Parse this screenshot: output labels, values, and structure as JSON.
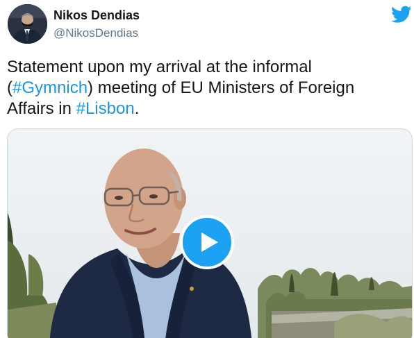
{
  "author": {
    "name": "Nikos Dendias",
    "handle": "@NikosDendias"
  },
  "tweet": {
    "line1": "Statement upon my arrival at the informal",
    "line2_prefix": "(",
    "hashtag1": "#Gymnich",
    "line2_suffix": ") meeting of EU Ministers of Foreign",
    "line3_prefix": "Affairs in ",
    "hashtag2": "#Lisbon",
    "line3_suffix": "."
  },
  "icons": {
    "brand": "twitter-bird-icon",
    "media": "play-icon"
  },
  "colors": {
    "accent": "#1da1f2",
    "hashtag": "#1b95e0",
    "handle": "#657786"
  }
}
